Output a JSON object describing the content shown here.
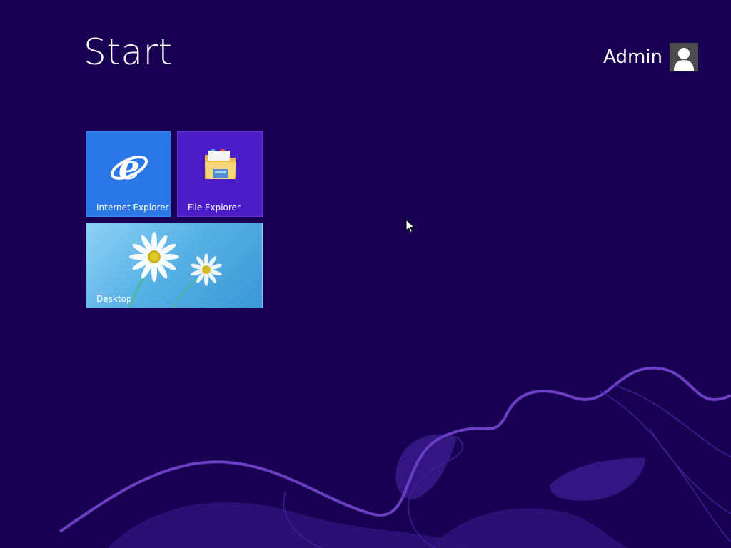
{
  "screen": {
    "title": "Start",
    "background_color": "#180052",
    "accent_wave_color": "#6a3fc4"
  },
  "user": {
    "name": "Admin",
    "avatar_icon": "user-silhouette-icon"
  },
  "tiles": [
    {
      "label": "Internet Explorer",
      "icon": "internet-explorer-icon",
      "color": "#2a77e7"
    },
    {
      "label": "File Explorer",
      "icon": "folder-icon",
      "color": "#4a1dc9"
    },
    {
      "label": "Desktop",
      "icon": "daisy-wallpaper",
      "color": "#5ab3e6"
    }
  ],
  "pointer": {
    "icon": "mouse-cursor-icon"
  }
}
